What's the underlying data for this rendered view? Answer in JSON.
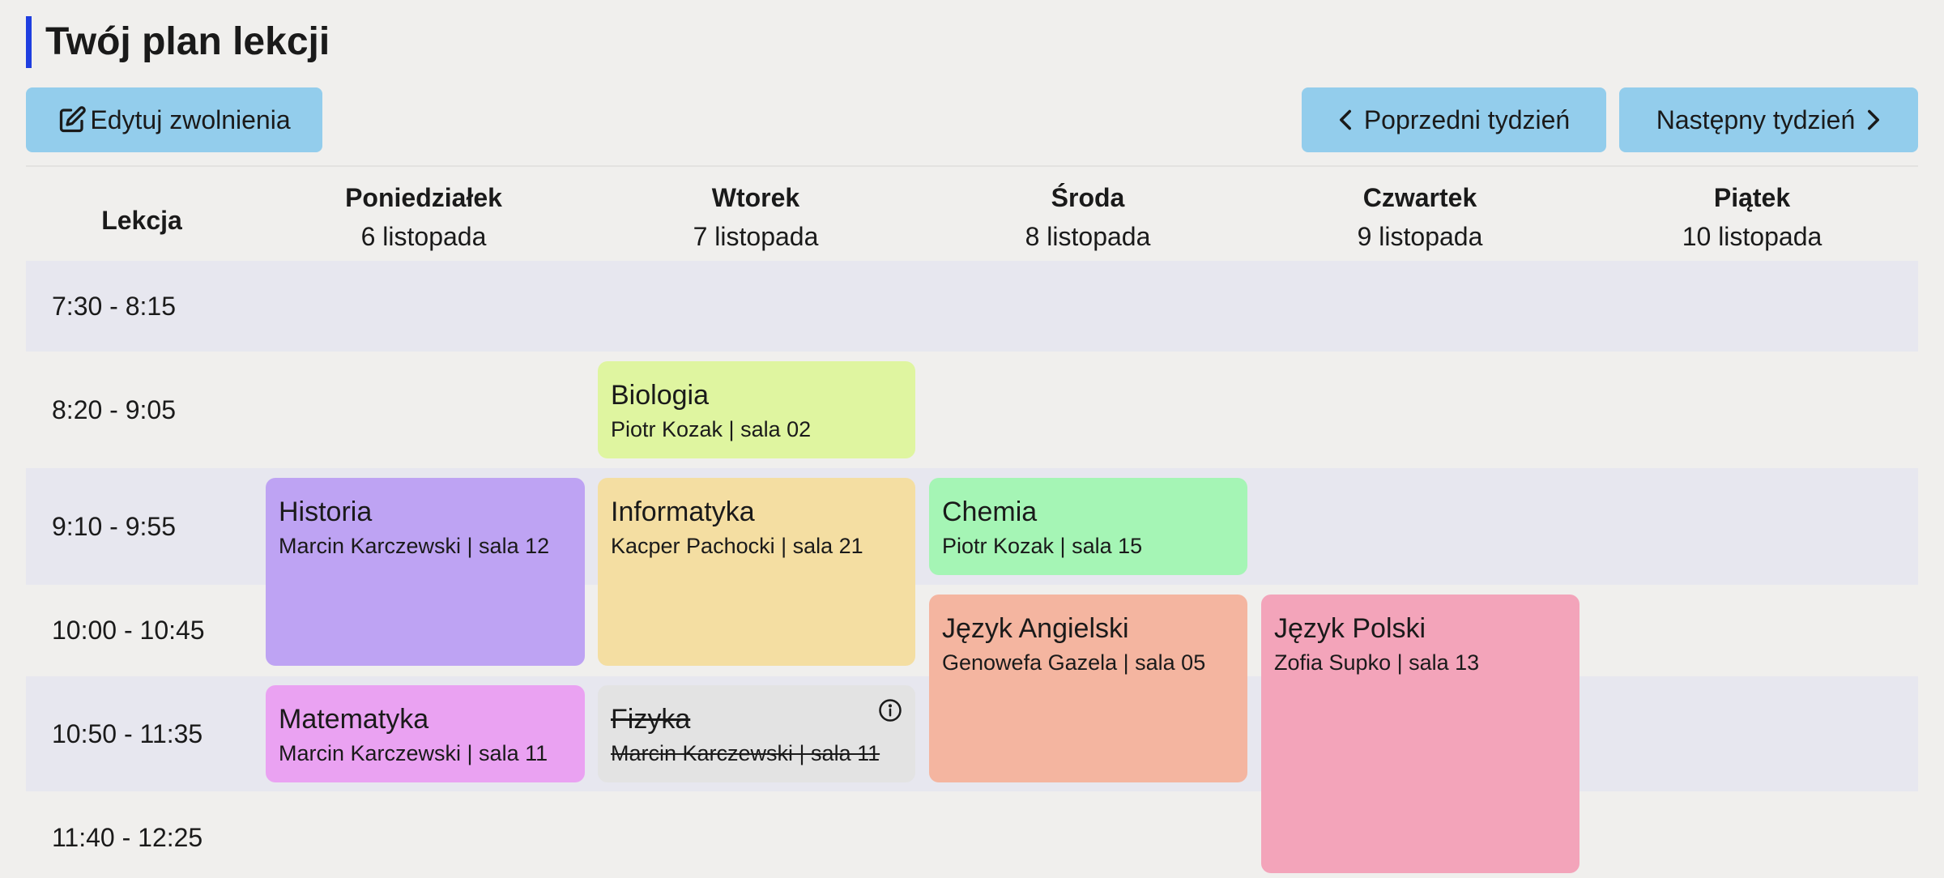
{
  "page": {
    "title": "Twój plan lekcji"
  },
  "toolbar": {
    "edit_label": "Edytuj zwolnienia",
    "prev_label": "Poprzedni tydzień",
    "next_label": "Następny tydzień"
  },
  "table": {
    "lesson_header": "Lekcja",
    "days": [
      {
        "name": "Poniedziałek",
        "date": "6 listopada"
      },
      {
        "name": "Wtorek",
        "date": "7 listopada"
      },
      {
        "name": "Środa",
        "date": "8 listopada"
      },
      {
        "name": "Czwartek",
        "date": "9 listopada"
      },
      {
        "name": "Piątek",
        "date": "10 listopada"
      }
    ],
    "times": [
      "7:30 - 8:15",
      "8:20 - 9:05",
      "9:10 - 9:55",
      "10:00 - 10:45",
      "10:50 - 11:35",
      "11:40 - 12:25"
    ]
  },
  "lessons": [
    {
      "subject": "Biologia",
      "details": "Piotr Kozak | sala 02",
      "color": "#dff5a0"
    },
    {
      "subject": "Historia",
      "details": "Marcin Karczewski | sala 12",
      "color": "#bea3f3"
    },
    {
      "subject": "Informatyka",
      "details": "Kacper Pachocki | sala 21",
      "color": "#f4dea2"
    },
    {
      "subject": "Chemia",
      "details": "Piotr Kozak | sala 15",
      "color": "#a5f5b5"
    },
    {
      "subject": "Język Angielski",
      "details": "Genowefa Gazela | sala 05",
      "color": "#f4b5a0"
    },
    {
      "subject": "Język Polski",
      "details": "Zofia Supko | sala 13",
      "color": "#f3a4ba"
    },
    {
      "subject": "Matematyka",
      "details": "Marcin Karczewski | sala 11",
      "color": "#eaa2f2"
    },
    {
      "subject": "Fizyka",
      "details": "Marcin Karczewski | sala 11",
      "color": "#e3e3e3",
      "status": "cancelled"
    }
  ],
  "icons": {
    "edit": "edit-icon",
    "prev": "chevron-left-icon",
    "next": "chevron-right-icon",
    "info": "info-icon"
  },
  "colors": {
    "accent": "#1f3ee0",
    "button": "#93cdec",
    "row_stripe": "#e7e7ef"
  }
}
